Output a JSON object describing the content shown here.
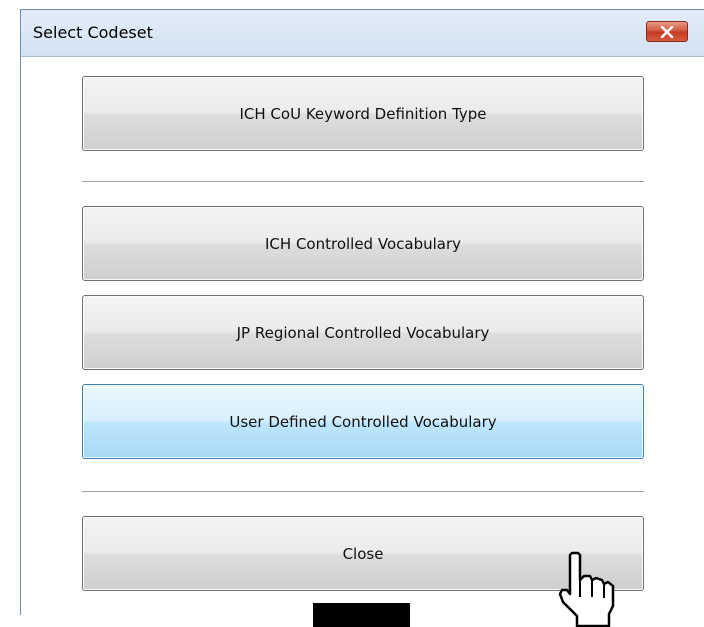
{
  "window": {
    "title": "Select Codeset"
  },
  "buttons": {
    "ich_cou_keyword": "ICH CoU Keyword Definition Type",
    "ich_controlled_vocab": "ICH Controlled Vocabulary",
    "jp_regional_vocab": "JP Regional Controlled Vocabulary",
    "user_defined_vocab": "User Defined Controlled Vocabulary",
    "close": "Close"
  },
  "icons": {
    "close_window": "close-x-icon",
    "pointer": "hand-pointer-icon"
  },
  "colors": {
    "title_bar": "#d9e6f4",
    "close_button": "#c9442b",
    "focused_button": "#bee6fd"
  }
}
